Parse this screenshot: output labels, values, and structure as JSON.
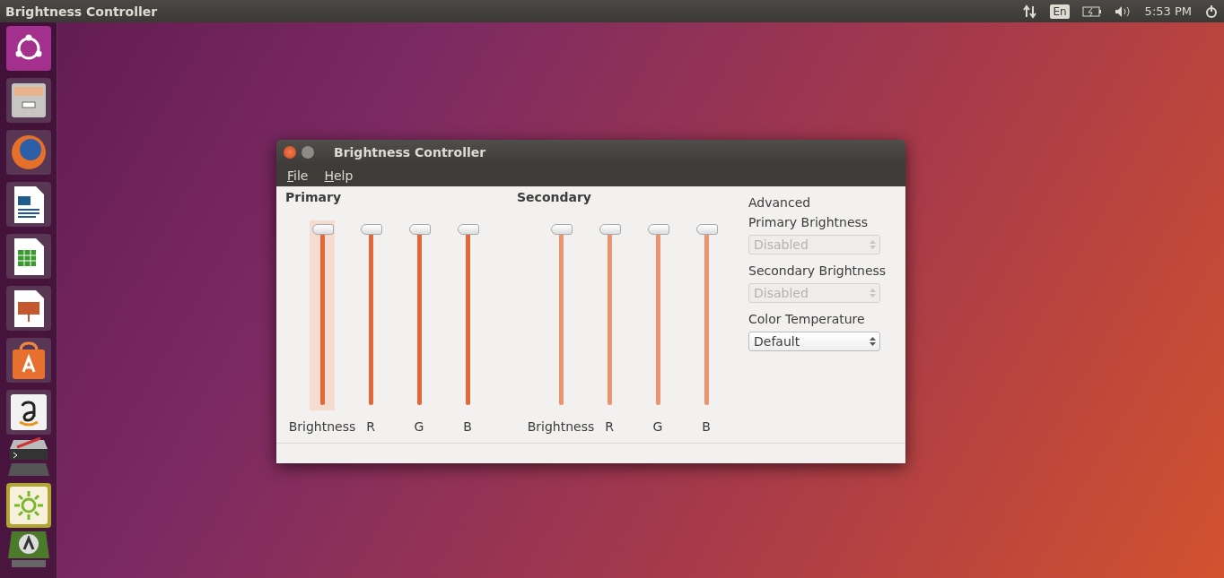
{
  "top_panel": {
    "app_title": "Brightness Controller",
    "keyboard_layout": "En",
    "clock": "5:53 PM"
  },
  "launcher": {
    "items": [
      {
        "kind": "dash"
      },
      {
        "kind": "files"
      },
      {
        "kind": "browser"
      },
      {
        "kind": "writer"
      },
      {
        "kind": "calc"
      },
      {
        "kind": "impress"
      },
      {
        "kind": "software"
      },
      {
        "kind": "amazon"
      },
      {
        "kind": "terminal-stack"
      },
      {
        "kind": "brightness"
      },
      {
        "kind": "updater"
      }
    ]
  },
  "window": {
    "title": "Brightness Controller",
    "menu": [
      "File",
      "Help"
    ],
    "groups": [
      {
        "title": "Primary",
        "sliders": [
          {
            "label": "Brightness",
            "level": 1,
            "focused": true,
            "disabled": false
          },
          {
            "label": "R",
            "level": 1,
            "focused": false,
            "disabled": false
          },
          {
            "label": "G",
            "level": 1,
            "focused": false,
            "disabled": false
          },
          {
            "label": "B",
            "level": 1,
            "focused": false,
            "disabled": false
          }
        ]
      },
      {
        "title": "Secondary",
        "sliders": [
          {
            "label": "Brightness",
            "level": 1,
            "focused": false,
            "disabled": true
          },
          {
            "label": "R",
            "level": 1,
            "focused": false,
            "disabled": true
          },
          {
            "label": "G",
            "level": 1,
            "focused": false,
            "disabled": true
          },
          {
            "label": "B",
            "level": 1,
            "focused": false,
            "disabled": true
          }
        ]
      }
    ],
    "advanced": {
      "title": "Advanced",
      "fields": [
        {
          "label": "Primary Brightness",
          "value": "Disabled",
          "disabled": true
        },
        {
          "label": "Secondary Brightness",
          "value": "Disabled",
          "disabled": true
        },
        {
          "label": "Color Temperature",
          "value": "Default",
          "disabled": false
        }
      ]
    }
  }
}
